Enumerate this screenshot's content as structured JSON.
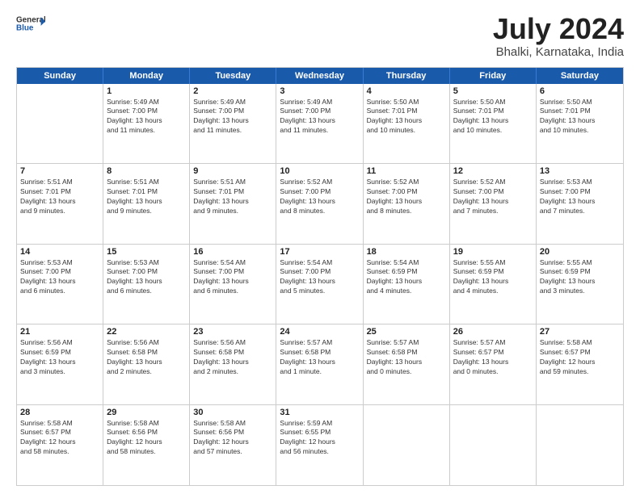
{
  "logo": {
    "general": "General",
    "blue": "Blue"
  },
  "title": {
    "month_year": "July 2024",
    "location": "Bhalki, Karnataka, India"
  },
  "weekdays": [
    "Sunday",
    "Monday",
    "Tuesday",
    "Wednesday",
    "Thursday",
    "Friday",
    "Saturday"
  ],
  "weeks": [
    [
      {
        "day": "",
        "info": ""
      },
      {
        "day": "1",
        "info": "Sunrise: 5:49 AM\nSunset: 7:00 PM\nDaylight: 13 hours\nand 11 minutes."
      },
      {
        "day": "2",
        "info": "Sunrise: 5:49 AM\nSunset: 7:00 PM\nDaylight: 13 hours\nand 11 minutes."
      },
      {
        "day": "3",
        "info": "Sunrise: 5:49 AM\nSunset: 7:00 PM\nDaylight: 13 hours\nand 11 minutes."
      },
      {
        "day": "4",
        "info": "Sunrise: 5:50 AM\nSunset: 7:01 PM\nDaylight: 13 hours\nand 10 minutes."
      },
      {
        "day": "5",
        "info": "Sunrise: 5:50 AM\nSunset: 7:01 PM\nDaylight: 13 hours\nand 10 minutes."
      },
      {
        "day": "6",
        "info": "Sunrise: 5:50 AM\nSunset: 7:01 PM\nDaylight: 13 hours\nand 10 minutes."
      }
    ],
    [
      {
        "day": "7",
        "info": "Sunrise: 5:51 AM\nSunset: 7:01 PM\nDaylight: 13 hours\nand 9 minutes."
      },
      {
        "day": "8",
        "info": "Sunrise: 5:51 AM\nSunset: 7:01 PM\nDaylight: 13 hours\nand 9 minutes."
      },
      {
        "day": "9",
        "info": "Sunrise: 5:51 AM\nSunset: 7:01 PM\nDaylight: 13 hours\nand 9 minutes."
      },
      {
        "day": "10",
        "info": "Sunrise: 5:52 AM\nSunset: 7:00 PM\nDaylight: 13 hours\nand 8 minutes."
      },
      {
        "day": "11",
        "info": "Sunrise: 5:52 AM\nSunset: 7:00 PM\nDaylight: 13 hours\nand 8 minutes."
      },
      {
        "day": "12",
        "info": "Sunrise: 5:52 AM\nSunset: 7:00 PM\nDaylight: 13 hours\nand 7 minutes."
      },
      {
        "day": "13",
        "info": "Sunrise: 5:53 AM\nSunset: 7:00 PM\nDaylight: 13 hours\nand 7 minutes."
      }
    ],
    [
      {
        "day": "14",
        "info": "Sunrise: 5:53 AM\nSunset: 7:00 PM\nDaylight: 13 hours\nand 6 minutes."
      },
      {
        "day": "15",
        "info": "Sunrise: 5:53 AM\nSunset: 7:00 PM\nDaylight: 13 hours\nand 6 minutes."
      },
      {
        "day": "16",
        "info": "Sunrise: 5:54 AM\nSunset: 7:00 PM\nDaylight: 13 hours\nand 6 minutes."
      },
      {
        "day": "17",
        "info": "Sunrise: 5:54 AM\nSunset: 7:00 PM\nDaylight: 13 hours\nand 5 minutes."
      },
      {
        "day": "18",
        "info": "Sunrise: 5:54 AM\nSunset: 6:59 PM\nDaylight: 13 hours\nand 4 minutes."
      },
      {
        "day": "19",
        "info": "Sunrise: 5:55 AM\nSunset: 6:59 PM\nDaylight: 13 hours\nand 4 minutes."
      },
      {
        "day": "20",
        "info": "Sunrise: 5:55 AM\nSunset: 6:59 PM\nDaylight: 13 hours\nand 3 minutes."
      }
    ],
    [
      {
        "day": "21",
        "info": "Sunrise: 5:56 AM\nSunset: 6:59 PM\nDaylight: 13 hours\nand 3 minutes."
      },
      {
        "day": "22",
        "info": "Sunrise: 5:56 AM\nSunset: 6:58 PM\nDaylight: 13 hours\nand 2 minutes."
      },
      {
        "day": "23",
        "info": "Sunrise: 5:56 AM\nSunset: 6:58 PM\nDaylight: 13 hours\nand 2 minutes."
      },
      {
        "day": "24",
        "info": "Sunrise: 5:57 AM\nSunset: 6:58 PM\nDaylight: 13 hours\nand 1 minute."
      },
      {
        "day": "25",
        "info": "Sunrise: 5:57 AM\nSunset: 6:58 PM\nDaylight: 13 hours\nand 0 minutes."
      },
      {
        "day": "26",
        "info": "Sunrise: 5:57 AM\nSunset: 6:57 PM\nDaylight: 13 hours\nand 0 minutes."
      },
      {
        "day": "27",
        "info": "Sunrise: 5:58 AM\nSunset: 6:57 PM\nDaylight: 12 hours\nand 59 minutes."
      }
    ],
    [
      {
        "day": "28",
        "info": "Sunrise: 5:58 AM\nSunset: 6:57 PM\nDaylight: 12 hours\nand 58 minutes."
      },
      {
        "day": "29",
        "info": "Sunrise: 5:58 AM\nSunset: 6:56 PM\nDaylight: 12 hours\nand 58 minutes."
      },
      {
        "day": "30",
        "info": "Sunrise: 5:58 AM\nSunset: 6:56 PM\nDaylight: 12 hours\nand 57 minutes."
      },
      {
        "day": "31",
        "info": "Sunrise: 5:59 AM\nSunset: 6:55 PM\nDaylight: 12 hours\nand 56 minutes."
      },
      {
        "day": "",
        "info": ""
      },
      {
        "day": "",
        "info": ""
      },
      {
        "day": "",
        "info": ""
      }
    ]
  ]
}
